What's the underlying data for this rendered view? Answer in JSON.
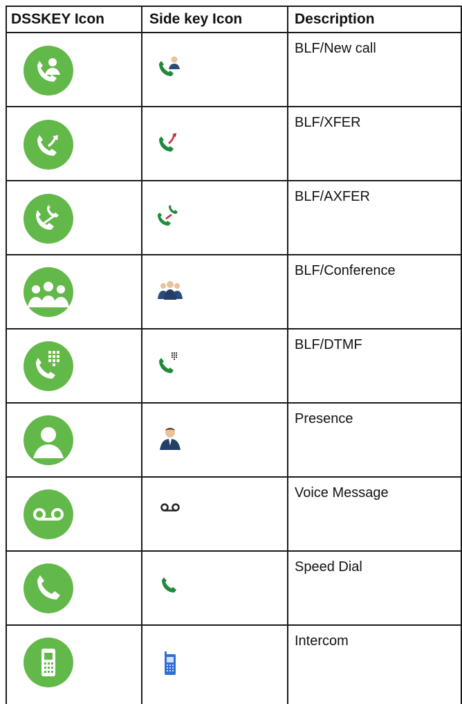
{
  "table": {
    "headers": [
      "DSSKEY Icon",
      "Side key Icon",
      "Description"
    ],
    "rows": [
      {
        "description": "BLF/New call",
        "icon": "phone-person-icon"
      },
      {
        "description": "BLF/XFER",
        "icon": "phone-transfer-icon"
      },
      {
        "description": "BLF/AXFER",
        "icon": "phone-attended-transfer-icon"
      },
      {
        "description": "BLF/Conference",
        "icon": "conference-icon"
      },
      {
        "description": "BLF/DTMF",
        "icon": "phone-keypad-icon"
      },
      {
        "description": "Presence",
        "icon": "person-icon"
      },
      {
        "description": "Voice Message",
        "icon": "voicemail-icon"
      },
      {
        "description": "Speed Dial",
        "icon": "phone-icon"
      },
      {
        "description": "Intercom",
        "icon": "mobile-phone-icon"
      }
    ]
  },
  "colors": {
    "green": "#63b84a",
    "dark_green": "#1e8a3a",
    "red": "#c0282d",
    "blue": "#2f6fd6",
    "border": "#1a1a1a"
  }
}
